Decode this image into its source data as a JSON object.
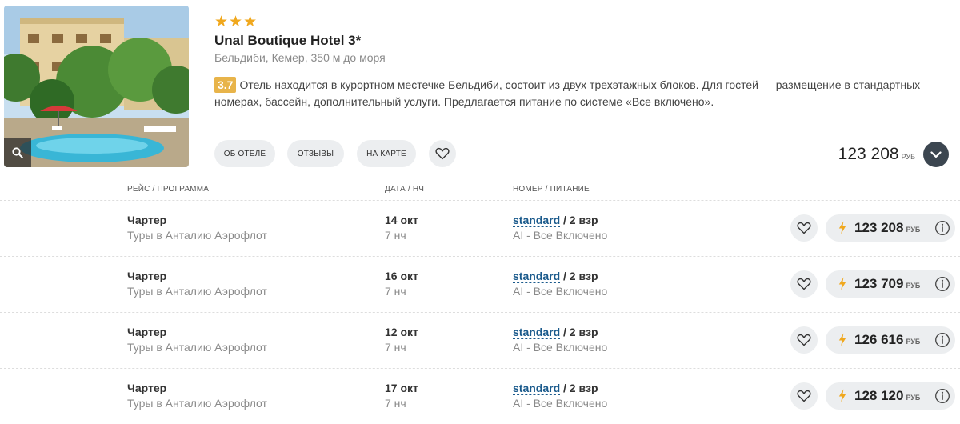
{
  "hotel": {
    "stars": "★★★",
    "name": "Unal Boutique Hotel 3*",
    "location": "Бельдиби, Кемер, 350 м до моря",
    "rating": "3.7",
    "description": "Отель находится в курортном местечке Бельдиби, состоит из двух трехэтажных блоков. Для гостей — размещение в стандартных номерах, бассейн, дополнительный услуги. Предлагается питание по системе «Все включено»."
  },
  "actions": {
    "about": "ОБ ОТЕЛЕ",
    "reviews": "ОТЗЫВЫ",
    "map": "НА КАРТЕ"
  },
  "summary": {
    "price": "123 208",
    "currency": "РУБ"
  },
  "columns": {
    "flight": "РЕЙС / ПРОГРАММА",
    "date": "ДАТА / НЧ",
    "room": "НОМЕР / ПИТАНИЕ"
  },
  "offers": [
    {
      "flight": "Чартер",
      "program": "Туры в Анталию Аэрофлот",
      "date": "14 окт",
      "nights": "7 нч",
      "room": "standard",
      "guests": "/ 2 взр",
      "meal": "AI - Все Включено",
      "price": "123 208",
      "currency": "РУБ"
    },
    {
      "flight": "Чартер",
      "program": "Туры в Анталию Аэрофлот",
      "date": "16 окт",
      "nights": "7 нч",
      "room": "standard",
      "guests": "/ 2 взр",
      "meal": "AI - Все Включено",
      "price": "123 709",
      "currency": "РУБ"
    },
    {
      "flight": "Чартер",
      "program": "Туры в Анталию Аэрофлот",
      "date": "12 окт",
      "nights": "7 нч",
      "room": "standard",
      "guests": "/ 2 взр",
      "meal": "AI - Все Включено",
      "price": "126 616",
      "currency": "РУБ"
    },
    {
      "flight": "Чартер",
      "program": "Туры в Анталию Аэрофлот",
      "date": "17 окт",
      "nights": "7 нч",
      "room": "standard",
      "guests": "/ 2 взр",
      "meal": "AI - Все Включено",
      "price": "128 120",
      "currency": "РУБ"
    }
  ],
  "colors": {
    "star": "#f0a81e",
    "rating_bg": "#e8b44a",
    "link": "#1a5a8c",
    "pill_bg": "#eceef0",
    "expand_bg": "#3c4650"
  },
  "icons": {
    "zoom": "search-icon",
    "favorite": "heart-icon",
    "expand": "chevron-down-icon",
    "instant": "lightning-icon",
    "info": "info-icon"
  }
}
